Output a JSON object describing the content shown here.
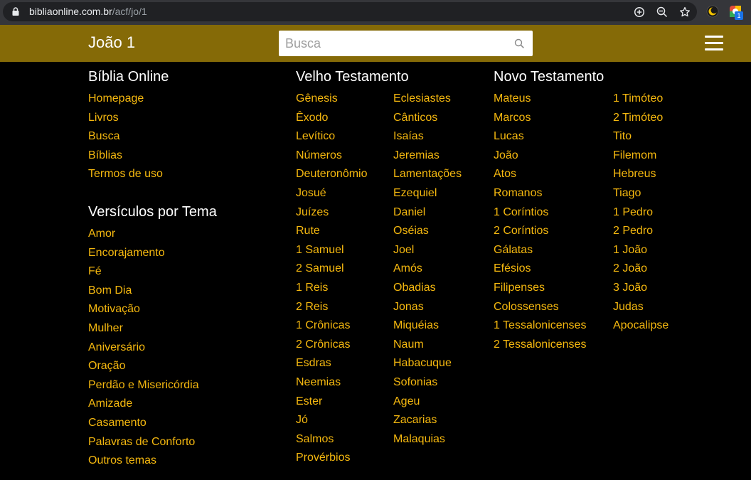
{
  "browser": {
    "url_domain": "bibliaonline.com.br",
    "url_path": "/acf/jo/1",
    "extension_badge": "1"
  },
  "header": {
    "title": "João 1",
    "search_placeholder": "Busca"
  },
  "sections": {
    "biblia_online": {
      "title": "Bíblia Online",
      "links": [
        "Homepage",
        "Livros",
        "Busca",
        "Bíblias",
        "Termos de uso"
      ]
    },
    "versiculos": {
      "title": "Versículos por Tema",
      "links": [
        "Amor",
        "Encorajamento",
        "Fé",
        "Bom Dia",
        "Motivação",
        "Mulher",
        "Aniversário",
        "Oração",
        "Perdão e Misericórdia",
        "Amizade",
        "Casamento",
        "Palavras de Conforto",
        "Outros temas"
      ]
    },
    "velho_testamento": {
      "title": "Velho Testamento",
      "col1": [
        "Gênesis",
        "Êxodo",
        "Levítico",
        "Números",
        "Deuteronômio",
        "Josué",
        "Juízes",
        "Rute",
        "1 Samuel",
        "2 Samuel",
        "1 Reis",
        "2 Reis",
        "1 Crônicas",
        "2 Crônicas",
        "Esdras",
        "Neemias",
        "Ester",
        "Jó",
        "Salmos",
        "Provérbios"
      ],
      "col2": [
        "Eclesiastes",
        "Cânticos",
        "Isaías",
        "Jeremias",
        "Lamentações",
        "Ezequiel",
        "Daniel",
        "Oséias",
        "Joel",
        "Amós",
        "Obadias",
        "Jonas",
        "Miquéias",
        "Naum",
        "Habacuque",
        "Sofonias",
        "Ageu",
        "Zacarias",
        "Malaquias"
      ]
    },
    "novo_testamento": {
      "title": "Novo Testamento",
      "col1": [
        "Mateus",
        "Marcos",
        "Lucas",
        "João",
        "Atos",
        "Romanos",
        "1 Coríntios",
        "2 Coríntios",
        "Gálatas",
        "Efésios",
        "Filipenses",
        "Colossenses",
        "1 Tessalonicenses",
        "2 Tessalonicenses"
      ],
      "col2": [
        "1 Timóteo",
        "2 Timóteo",
        "Tito",
        "Filemom",
        "Hebreus",
        "Tiago",
        "1 Pedro",
        "2 Pedro",
        "1 João",
        "2 João",
        "3 João",
        "Judas",
        "Apocalipse"
      ]
    }
  },
  "colors": {
    "header_bg": "#856a07",
    "link": "#f5b80f",
    "background": "#000000"
  }
}
